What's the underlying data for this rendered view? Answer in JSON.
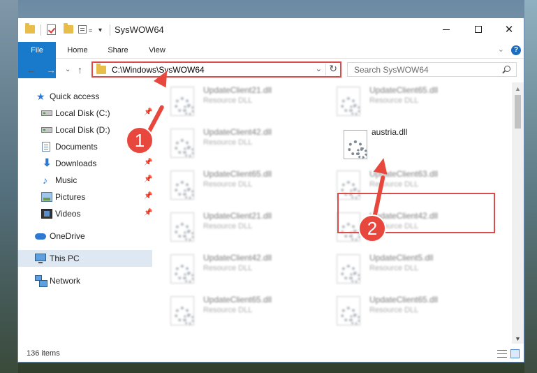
{
  "window": {
    "title": "SysWOW64",
    "controls": {
      "minimize": "—",
      "maximize": "☐",
      "close": "✕"
    }
  },
  "ribbon": {
    "tabs": [
      "File",
      "Home",
      "Share",
      "View"
    ],
    "help": "?"
  },
  "navigation": {
    "address": "C:\\Windows\\SysWOW64",
    "search_placeholder": "Search SysWOW64"
  },
  "sidebar": {
    "quick_access": "Quick access",
    "items": [
      {
        "label": "Local Disk (C:)",
        "icon": "drive-icon",
        "pinned": true
      },
      {
        "label": "Local Disk (D:)",
        "icon": "drive-icon",
        "pinned": false
      },
      {
        "label": "Documents",
        "icon": "documents-icon",
        "pinned": true
      },
      {
        "label": "Downloads",
        "icon": "downloads-icon",
        "pinned": true
      },
      {
        "label": "Music",
        "icon": "music-icon",
        "pinned": true
      },
      {
        "label": "Pictures",
        "icon": "pictures-icon",
        "pinned": true
      },
      {
        "label": "Videos",
        "icon": "videos-icon",
        "pinned": true
      }
    ],
    "onedrive": "OneDrive",
    "this_pc": "This PC",
    "network": "Network"
  },
  "files": {
    "left_column": [
      {
        "name": "UpdateClient21.dll",
        "type": "Resource DLL"
      },
      {
        "name": "UpdateClient42.dll",
        "type": "Resource DLL"
      },
      {
        "name": "UpdateClient65.dll",
        "type": "Resource DLL"
      },
      {
        "name": "UpdateClient21.dll",
        "type": "Resource DLL"
      },
      {
        "name": "UpdateClient42.dll",
        "type": "Resource DLL"
      },
      {
        "name": "UpdateClient65.dll",
        "type": "Resource DLL"
      }
    ],
    "right_column": [
      {
        "name": "UpdateClient65.dll",
        "type": "Resource DLL"
      },
      {
        "name": "austria.dll",
        "type": ""
      },
      {
        "name": "UpdateClient63.dll",
        "type": "Resource DLL"
      },
      {
        "name": "UpdateClient42.dll",
        "type": "Resource DLL"
      },
      {
        "name": "UpdateClient5.dll",
        "type": "Resource DLL"
      },
      {
        "name": "UpdateClient65.dll",
        "type": "Resource DLL"
      }
    ]
  },
  "status": {
    "item_count": "136 items"
  },
  "annotations": {
    "step1": "1",
    "step2": "2",
    "color": "#e8473d"
  }
}
